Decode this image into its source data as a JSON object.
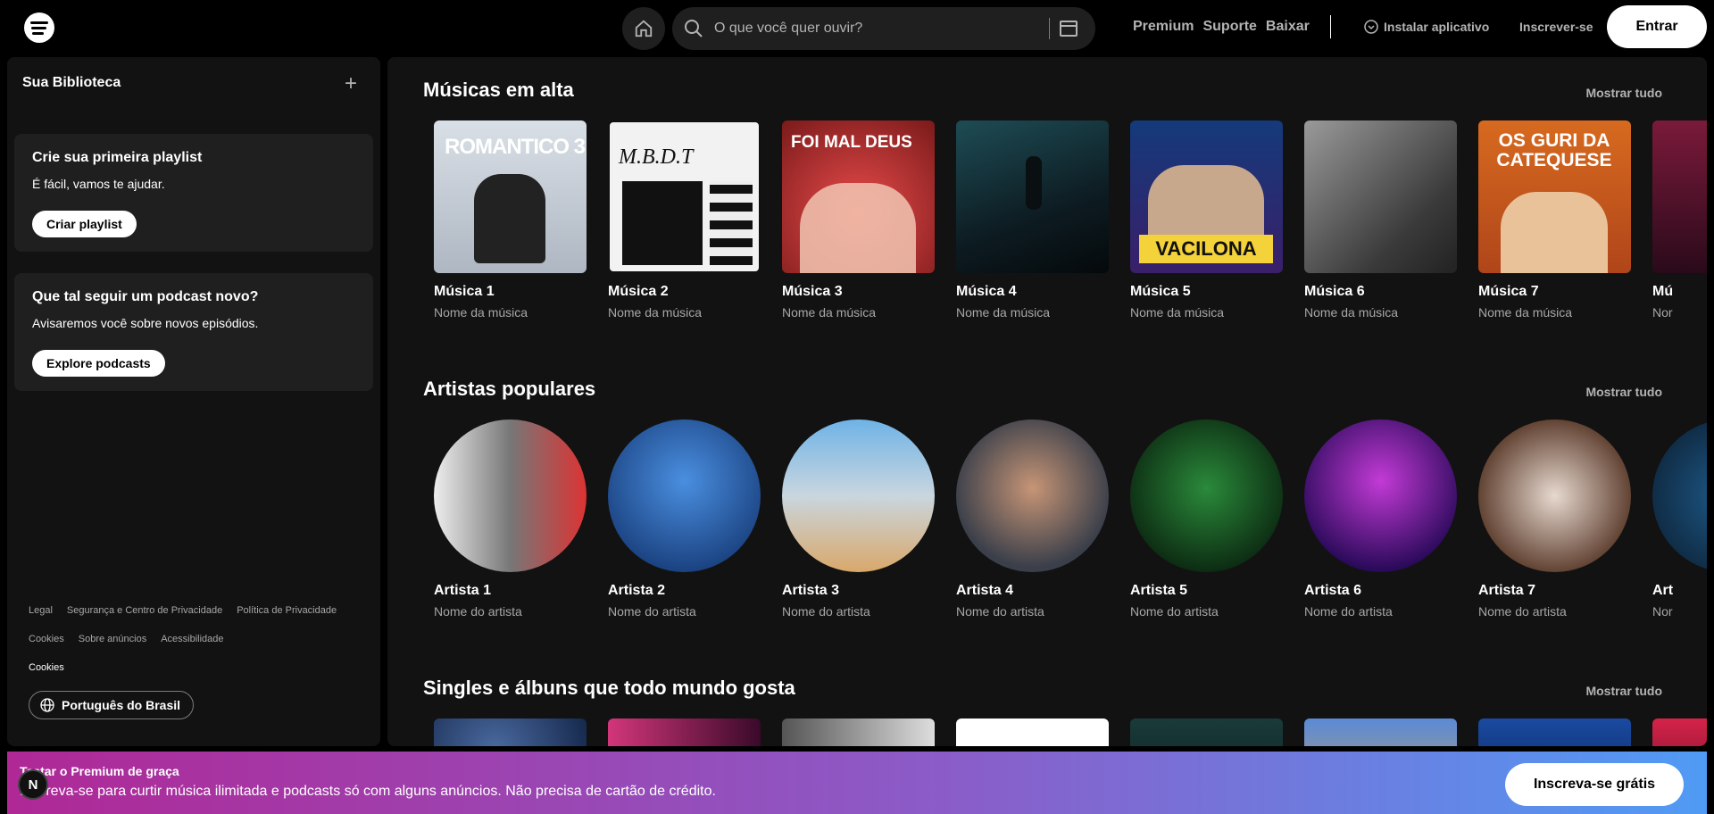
{
  "topbar": {
    "search_placeholder": "O que você quer ouvir?",
    "nav_links": [
      "Premium",
      "Suporte",
      "Baixar"
    ],
    "install_label": "Instalar aplicativo",
    "signup_label": "Inscrever-se",
    "login_label": "Entrar"
  },
  "sidebar": {
    "title": "Sua Biblioteca",
    "add_icon": "+",
    "playlist_card": {
      "title": "Crie sua primeira playlist",
      "text": "É fácil, vamos te ajudar.",
      "button": "Criar playlist"
    },
    "podcast_card": {
      "title": "Que tal seguir um podcast novo?",
      "text": "Avisaremos você sobre novos episódios.",
      "button": "Explore podcasts"
    },
    "footer_links": {
      "row1": [
        "Legal",
        "Segurança e Centro de Privacidade",
        "Política de Privacidade"
      ],
      "row2": [
        "Cookies",
        "Sobre anúncios",
        "Acessibilidade"
      ],
      "row3": "Cookies"
    },
    "language_button": "Português do Brasil"
  },
  "main": {
    "trending": {
      "title": "Músicas em alta",
      "show_all": "Mostrar tudo",
      "items": [
        {
          "title": "Música 1",
          "subtitle": "Nome da música",
          "cover_text": "ROMANTICO 3"
        },
        {
          "title": "Música 2",
          "subtitle": "Nome da música",
          "cover_text": "M.B.D.T"
        },
        {
          "title": "Música 3",
          "subtitle": "Nome da música",
          "cover_text": "FOI MAL DEUS"
        },
        {
          "title": "Música 4",
          "subtitle": "Nome da música",
          "cover_text": ""
        },
        {
          "title": "Música 5",
          "subtitle": "Nome da música",
          "cover_text": "VACILONA"
        },
        {
          "title": "Música 6",
          "subtitle": "Nome da música",
          "cover_text": ""
        },
        {
          "title": "Música 7",
          "subtitle": "Nome da música",
          "cover_text": "OS GURI DA CATEQUESE"
        },
        {
          "title": "Mú",
          "subtitle": "Nor",
          "cover_text": ""
        }
      ]
    },
    "artists": {
      "title": "Artistas populares",
      "show_all": "Mostrar tudo",
      "items": [
        {
          "title": "Artista 1",
          "subtitle": "Nome do artista"
        },
        {
          "title": "Artista 2",
          "subtitle": "Nome do artista"
        },
        {
          "title": "Artista 3",
          "subtitle": "Nome do artista"
        },
        {
          "title": "Artista 4",
          "subtitle": "Nome do artista"
        },
        {
          "title": "Artista 5",
          "subtitle": "Nome do artista"
        },
        {
          "title": "Artista 6",
          "subtitle": "Nome do artista"
        },
        {
          "title": "Artista 7",
          "subtitle": "Nome do artista"
        },
        {
          "title": "Art",
          "subtitle": "Nor"
        }
      ]
    },
    "singles": {
      "title": "Singles e álbuns que todo mundo gosta",
      "show_all": "Mostrar tudo"
    }
  },
  "banner": {
    "title": "Testar o Premium de graça",
    "text": "Inscreva-se para curtir música ilimitada e podcasts só com alguns anúncios. Não precisa de cartão de crédito.",
    "cta": "Inscreva-se grátis",
    "badge": "N"
  },
  "colors": {
    "background": "#000000",
    "panel": "#121212",
    "card": "#1f1f1f",
    "muted_text": "#b3b3b3",
    "banner_start": "#af2896",
    "banner_end": "#509bf5"
  },
  "icons": [
    "spotify-logo-icon",
    "home-icon",
    "search-icon",
    "browse-icon",
    "download-circle-icon",
    "plus-icon",
    "globe-icon"
  ]
}
